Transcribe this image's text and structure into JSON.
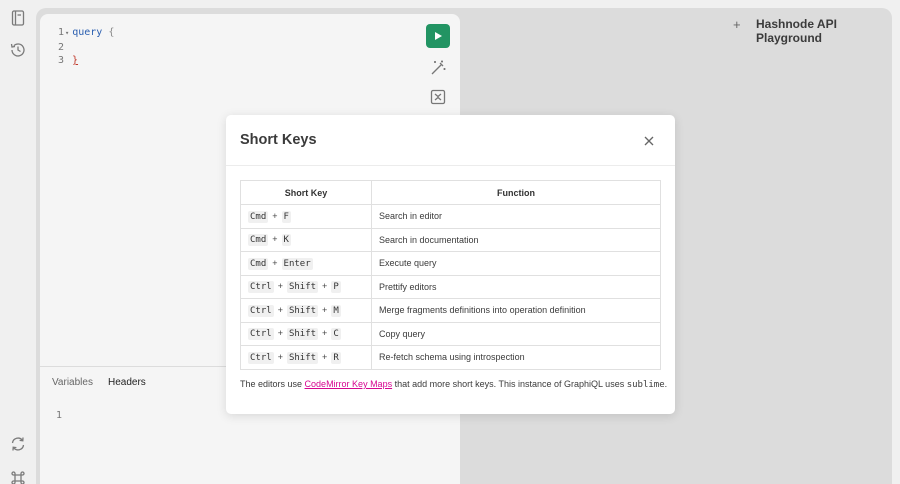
{
  "header": {
    "title": "Hashnode API Playground"
  },
  "editor": {
    "lines": [
      {
        "num": "1",
        "text": "query",
        "brace": "{"
      },
      {
        "num": "2",
        "text": ""
      },
      {
        "num": "3",
        "brace": "}"
      }
    ]
  },
  "bottom_tabs": [
    {
      "label": "Variables"
    },
    {
      "label": "Headers"
    }
  ],
  "variables_editor": {
    "line_numbers": [
      "1"
    ]
  },
  "modal": {
    "title": "Short Keys",
    "table": {
      "headers": [
        "Short Key",
        "Function"
      ],
      "rows": [
        {
          "keys": [
            "Cmd",
            "F"
          ],
          "function": "Search in editor"
        },
        {
          "keys": [
            "Cmd",
            "K"
          ],
          "function": "Search in documentation"
        },
        {
          "keys": [
            "Cmd",
            "Enter"
          ],
          "function": "Execute query"
        },
        {
          "keys": [
            "Ctrl",
            "Shift",
            "P"
          ],
          "function": "Prettify editors"
        },
        {
          "keys": [
            "Ctrl",
            "Shift",
            "M"
          ],
          "function": "Merge fragments definitions into operation definition"
        },
        {
          "keys": [
            "Ctrl",
            "Shift",
            "C"
          ],
          "function": "Copy query"
        },
        {
          "keys": [
            "Ctrl",
            "Shift",
            "R"
          ],
          "function": "Re-fetch schema using introspection"
        }
      ]
    },
    "footnote": {
      "before": "The editors use ",
      "link": "CodeMirror Key Maps",
      "middle": " that add more short keys. This instance of GraphiQL uses ",
      "code": "sublime",
      "after": "."
    }
  },
  "colors": {
    "run_button": "#229463",
    "link": "#d60590"
  }
}
